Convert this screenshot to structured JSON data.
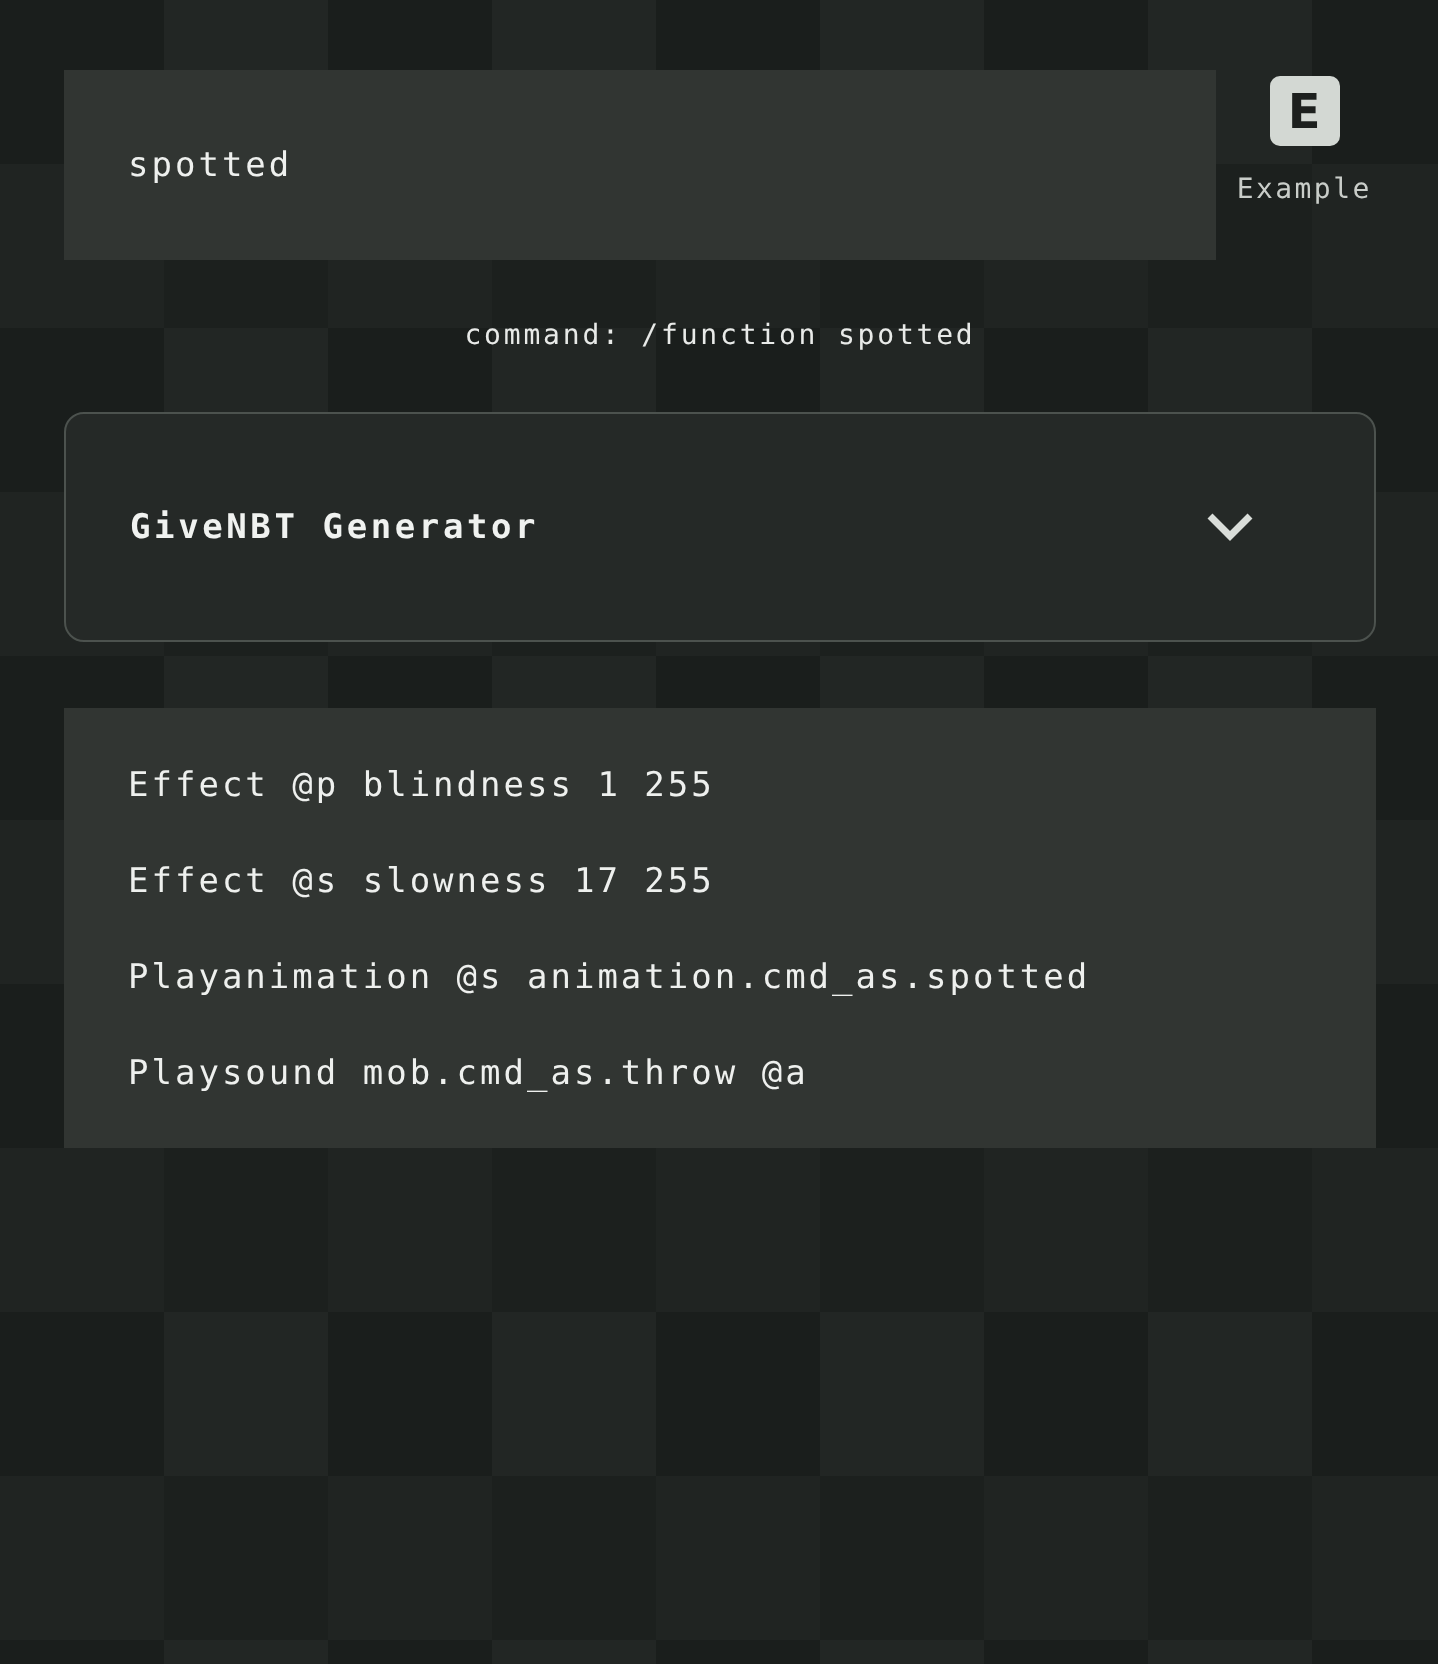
{
  "function_field": {
    "value": "spotted"
  },
  "example_button": {
    "icon_letter": "E",
    "label": "Example"
  },
  "command": "command: /function spotted",
  "generator_dropdown": {
    "title": "GiveNBT Generator",
    "expanded": false
  },
  "commands": [
    "Effect @p blindness 1 255",
    "Effect @s slowness 17 255",
    "Playanimation @s animation.cmd_as.spotted",
    "Playsound mob.cmd_as.throw @a"
  ]
}
